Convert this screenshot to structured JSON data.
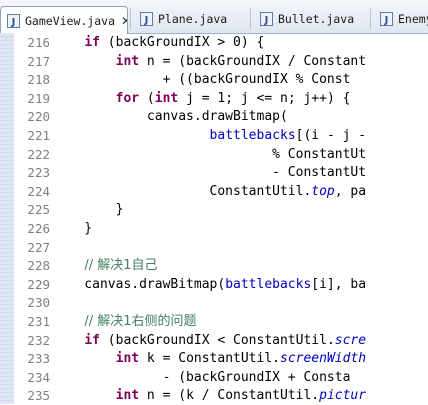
{
  "tabs": [
    {
      "label": "GameView.java",
      "active": true,
      "close": "✕"
    },
    {
      "label": "Plane.java",
      "active": false
    },
    {
      "label": "Bullet.java",
      "active": false
    },
    {
      "label": "Enemy",
      "active": false
    }
  ],
  "colors": {
    "keyword": "#7f0055",
    "field": "#0000c0",
    "comment": "#3f7f5f",
    "line_number": "#7f7f7f"
  },
  "lines": [
    {
      "num": "216",
      "segs": [
        [
          "n",
          "    "
        ],
        [
          "k",
          "if"
        ],
        [
          "n",
          " (backGroundIX > 0) {"
        ]
      ]
    },
    {
      "num": "217",
      "segs": [
        [
          "n",
          "        "
        ],
        [
          "k",
          "int"
        ],
        [
          "n",
          " n = (backGroundIX / Constant"
        ]
      ]
    },
    {
      "num": "218",
      "segs": [
        [
          "n",
          "              + ((backGroundIX % Const"
        ]
      ]
    },
    {
      "num": "219",
      "segs": [
        [
          "n",
          "        "
        ],
        [
          "k",
          "for"
        ],
        [
          "n",
          " ("
        ],
        [
          "k",
          "int"
        ],
        [
          "n",
          " j = 1; j <= n; j++) {"
        ]
      ]
    },
    {
      "num": "220",
      "segs": [
        [
          "n",
          "            canvas.drawBitmap("
        ]
      ]
    },
    {
      "num": "221",
      "segs": [
        [
          "n",
          "                    "
        ],
        [
          "f",
          "battlebacks"
        ],
        [
          "n",
          "[(i - j -"
        ]
      ]
    },
    {
      "num": "222",
      "segs": [
        [
          "n",
          "                            % ConstantUt"
        ]
      ]
    },
    {
      "num": "223",
      "segs": [
        [
          "n",
          "                            - ConstantUt"
        ]
      ]
    },
    {
      "num": "224",
      "segs": [
        [
          "n",
          "                    ConstantUtil."
        ],
        [
          "s",
          "top"
        ],
        [
          "n",
          ", pa"
        ]
      ]
    },
    {
      "num": "225",
      "segs": [
        [
          "n",
          "        }"
        ]
      ]
    },
    {
      "num": "226",
      "segs": [
        [
          "n",
          "    }"
        ]
      ]
    },
    {
      "num": "227",
      "segs": [
        [
          "n",
          ""
        ]
      ]
    },
    {
      "num": "228",
      "segs": [
        [
          "n",
          "    "
        ],
        [
          "c",
          "// 解决1自己"
        ]
      ]
    },
    {
      "num": "229",
      "segs": [
        [
          "n",
          "    canvas.drawBitmap("
        ],
        [
          "f",
          "battlebacks"
        ],
        [
          "n",
          "[i], ba"
        ]
      ]
    },
    {
      "num": "230",
      "segs": [
        [
          "n",
          ""
        ]
      ]
    },
    {
      "num": "231",
      "segs": [
        [
          "n",
          "    "
        ],
        [
          "c",
          "// 解决1右侧的问题"
        ]
      ]
    },
    {
      "num": "232",
      "segs": [
        [
          "n",
          "    "
        ],
        [
          "k",
          "if"
        ],
        [
          "n",
          " (backGroundIX < ConstantUtil."
        ],
        [
          "s",
          "scre"
        ]
      ]
    },
    {
      "num": "233",
      "segs": [
        [
          "n",
          "        "
        ],
        [
          "k",
          "int"
        ],
        [
          "n",
          " k = ConstantUtil."
        ],
        [
          "s",
          "screenWidth"
        ]
      ]
    },
    {
      "num": "234",
      "segs": [
        [
          "n",
          "              - (backGroundIX + Consta"
        ]
      ]
    },
    {
      "num": "235",
      "segs": [
        [
          "n",
          "        "
        ],
        [
          "k",
          "int"
        ],
        [
          "n",
          " n = (k / ConstantUtil."
        ],
        [
          "s",
          "pictur"
        ]
      ]
    }
  ]
}
